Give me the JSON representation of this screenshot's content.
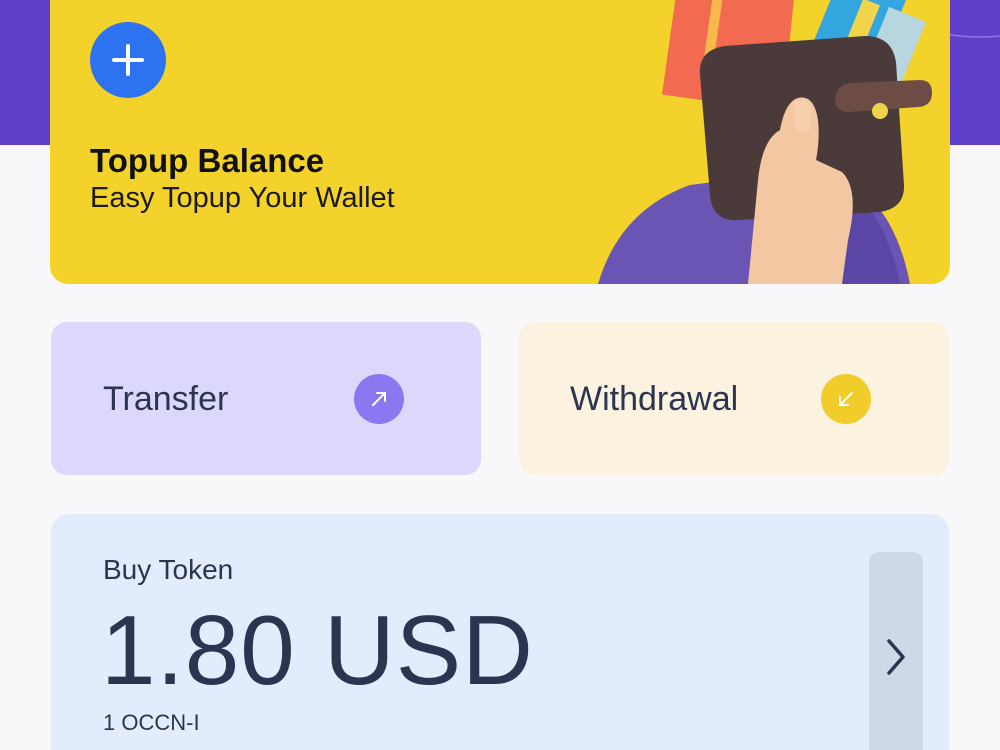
{
  "colors": {
    "header": "#5e3fc8",
    "topup_card": "#f4d22c",
    "plus_button": "#2d72f0",
    "transfer_card": "#dcd8fc",
    "transfer_icon": "#8a78f0",
    "withdraw_card": "#fbf2df",
    "withdraw_icon": "#f0cd2a",
    "token_card": "#e3ecfd",
    "text_dark": "#2b3550"
  },
  "topup": {
    "title": "Topup Balance",
    "subtitle": "Easy Topup Your Wallet",
    "icon": "plus-icon",
    "illustration": "wallet-in-hand-illustration"
  },
  "actions": {
    "transfer": {
      "label": "Transfer",
      "icon": "arrow-up-right-icon"
    },
    "withdrawal": {
      "label": "Withdrawal",
      "icon": "arrow-down-left-icon"
    }
  },
  "token": {
    "title": "Buy Token",
    "amount": "1.80 USD",
    "unit": "1 OCCN-I",
    "icon": "chevron-right-icon"
  }
}
